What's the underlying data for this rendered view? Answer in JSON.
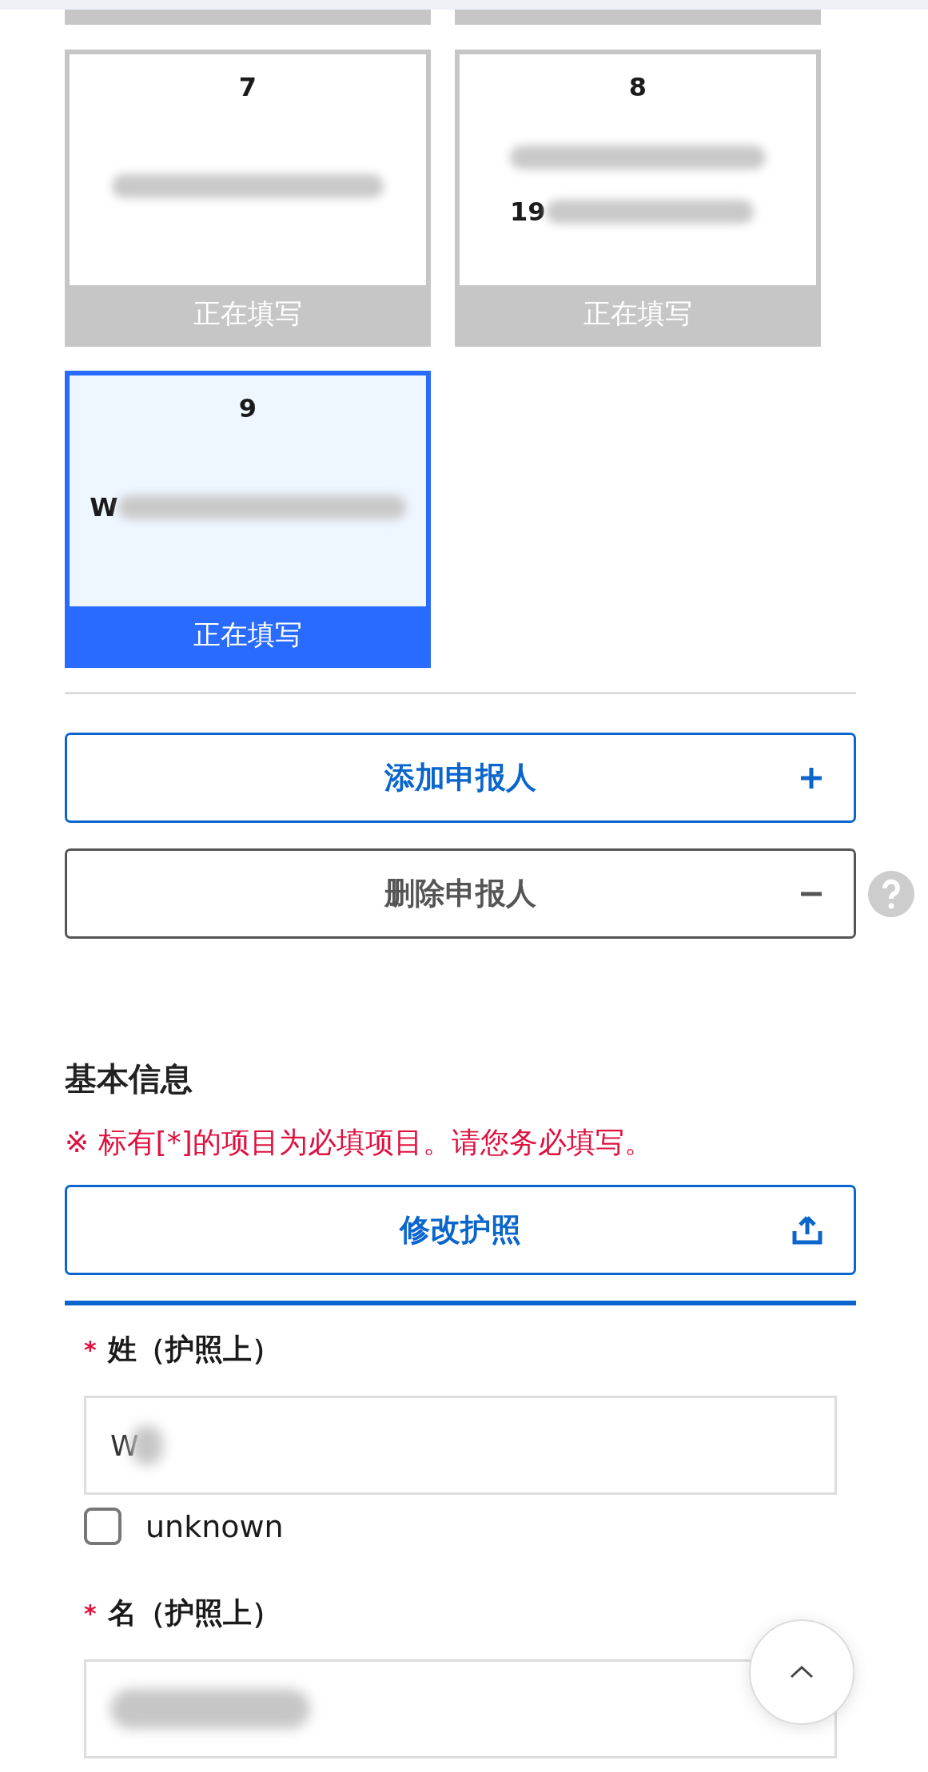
{
  "applicants": [
    {
      "kind": "partial",
      "selected": false
    },
    {
      "kind": "partial",
      "selected": false
    },
    {
      "kind": "card",
      "selected": false,
      "number": "7",
      "lines": [
        {
          "kind": "blurred"
        }
      ],
      "status": "正在填写"
    },
    {
      "kind": "card",
      "selected": false,
      "number": "8",
      "lines": [
        {
          "kind": "blurred"
        },
        {
          "kind": "prefixed",
          "text": "19"
        }
      ],
      "status": "正在填写"
    },
    {
      "kind": "card",
      "selected": true,
      "number": "9",
      "lines": [
        {
          "kind": "prefixed",
          "text": "W"
        }
      ],
      "status": "正在填写"
    }
  ],
  "actions": [
    {
      "kind": "add",
      "label": "添加申报人"
    },
    {
      "kind": "delete",
      "label": "删除申报人"
    }
  ],
  "section": {
    "title": "基本信息",
    "note": "※ 标有[*]的项目为必填项目。请您务必填写。",
    "passport_button": "修改护照"
  },
  "fields": [
    {
      "required_mark": "*",
      "label": "姓（护照上）",
      "value": "W",
      "unknown": {
        "label": "unknown",
        "checked": false
      }
    },
    {
      "required_mark": "*",
      "label": "名（护照上）"
    }
  ]
}
